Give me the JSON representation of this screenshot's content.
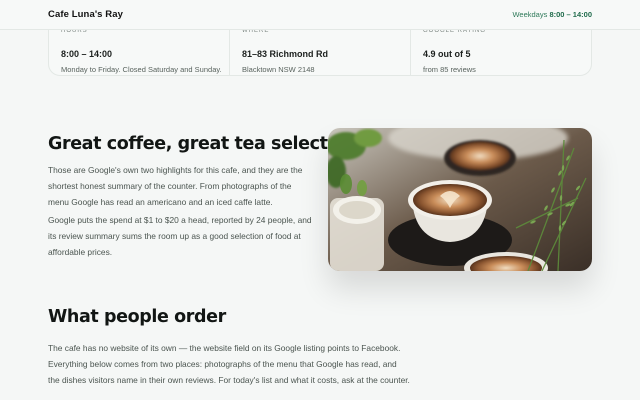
{
  "header": {
    "brand": "Cafe Luna's Ray",
    "hours_label": "Weekdays",
    "hours_value": "8:00 – 14:00"
  },
  "info": {
    "hours": {
      "label": "Hours",
      "value": "8:00 – 14:00",
      "note": "Monday to Friday. Closed Saturday and Sunday."
    },
    "where": {
      "label": "Where",
      "value": "81–83 Richmond Rd",
      "note": "Blacktown NSW 2148"
    },
    "rating": {
      "label": "Google rating",
      "value": "4.9 out of 5",
      "note": "from 85 reviews"
    }
  },
  "section_coffee": {
    "heading": "Great coffee, great tea selection",
    "para1": "Those are Google's own two highlights for this cafe, and they are the shortest honest summary of the counter. From photographs of the menu Google has read an americano and an iced caffe latte.",
    "para2": "Google puts the spend at $1 to $20 a head, reported by 24 people, and its review summary sums the room up as a good selection of food at affordable prices."
  },
  "section_order": {
    "heading": "What people order",
    "para": "The cafe has no website of its own — the website field on its Google listing points to Facebook. Everything below comes from two places: photographs of the menu that Google has read, and the dishes visitors name in their own reviews. For today's list and what it costs, ask at the counter."
  },
  "colors": {
    "accent": "#1f6b4b",
    "background": "#f5f7f6"
  }
}
